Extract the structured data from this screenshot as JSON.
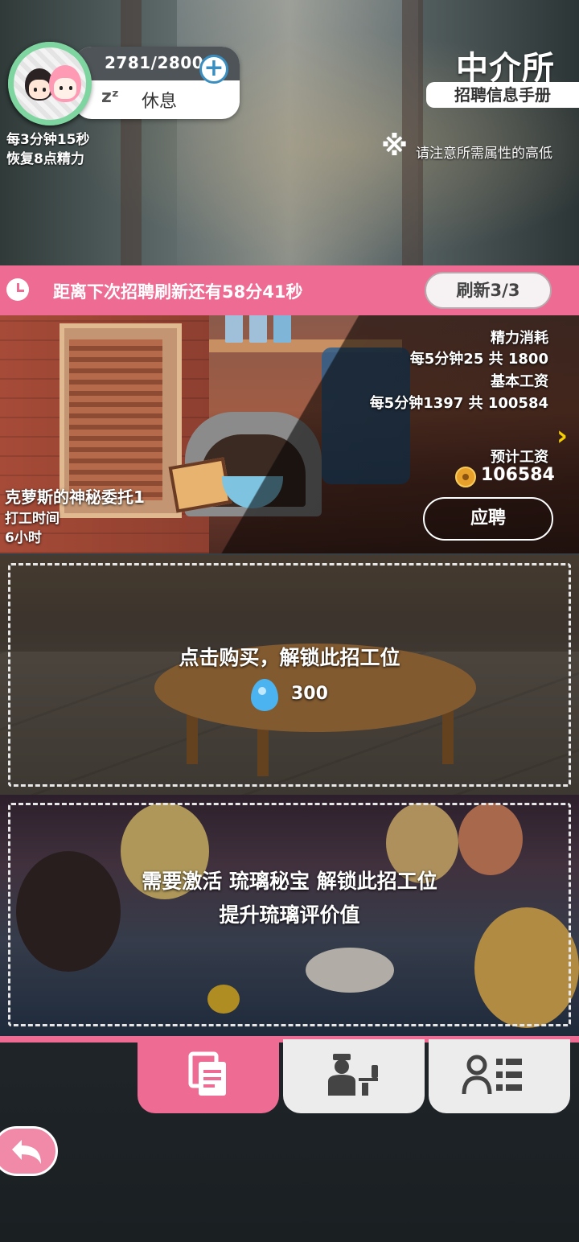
{
  "status": {
    "energy": "2781/2800",
    "rest_label": "休息",
    "zzz": "zᶻ",
    "regen_line1": "每3分钟15秒",
    "regen_line2": "恢复8点精力"
  },
  "header": {
    "title": "中介所",
    "subtitle": "招聘信息手册",
    "note_mark": "※",
    "note": "请注意所需属性的高低"
  },
  "timer": {
    "text": "距离下次招聘刷新还有58分41秒",
    "refresh_label": "刷新3/3"
  },
  "job": {
    "name": "克萝斯的神秘委托1",
    "time_label": "打工时间",
    "time_value": "6小时",
    "energy_cost_label": "精力消耗",
    "energy_cost_value": "每5分钟25 共 1800",
    "base_wage_label": "基本工资",
    "base_wage_value": "每5分钟1397 共 100584",
    "expected_wage_label": "预计工资",
    "expected_wage_value": "106584",
    "apply_label": "应聘"
  },
  "slot_buy": {
    "text": "点击购买，解锁此招工位",
    "price": "300"
  },
  "slot_activate": {
    "line1": "需要激活 琉璃秘宝 解锁此招工位",
    "line2": "提升琉璃评价值"
  },
  "tabs": [
    {
      "icon": "document-icon",
      "active": true
    },
    {
      "icon": "waiter-icon",
      "active": false
    },
    {
      "icon": "user-list-icon",
      "active": false
    }
  ],
  "colors": {
    "accent_pink": "#ee6b93",
    "coin_gold": "#e7a12a",
    "gem_blue": "#4bb3f0",
    "arrow_yellow": "#f5d000"
  }
}
